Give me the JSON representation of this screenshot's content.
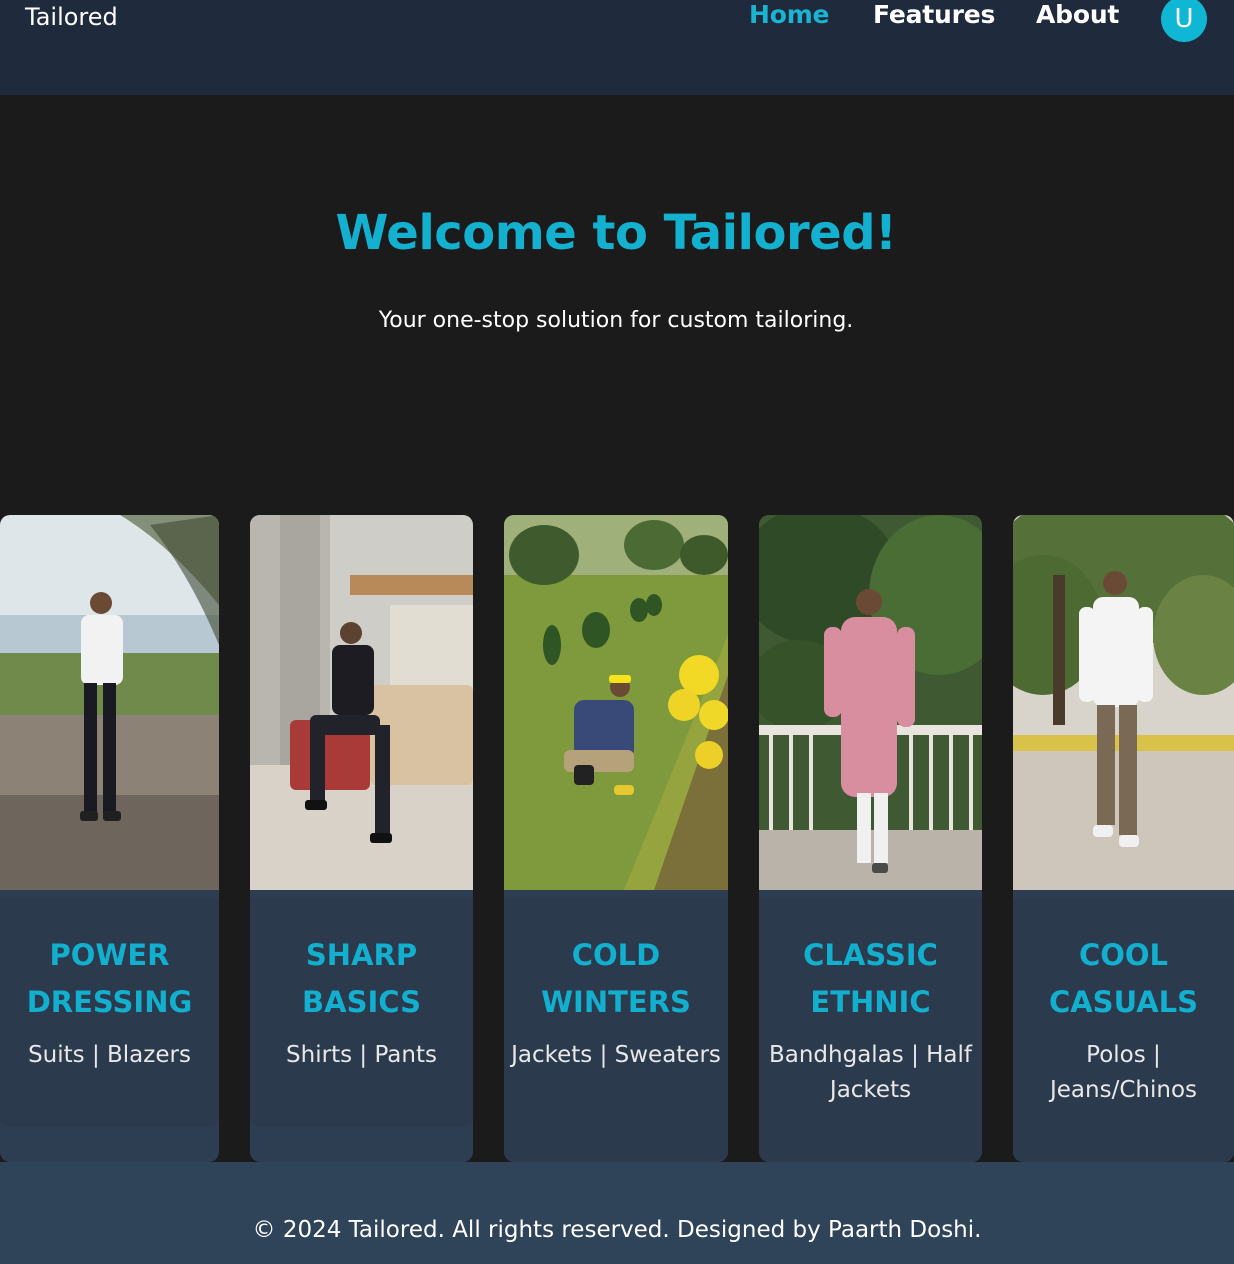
{
  "navbar": {
    "brand": "Tailored",
    "links": [
      {
        "label": "Home",
        "active": true
      },
      {
        "label": "Features",
        "active": false
      },
      {
        "label": "About",
        "active": false
      }
    ],
    "avatar_initial": "U"
  },
  "hero": {
    "title": "Welcome to Tailored!",
    "subtitle": "Your one-stop solution for custom tailoring."
  },
  "cards": [
    {
      "title": "POWER DRESSING",
      "description": "Suits | Blazers"
    },
    {
      "title": "SHARP BASICS",
      "description": "Shirts | Pants"
    },
    {
      "title": "COLD WINTERS",
      "description": "Jackets | Sweaters"
    },
    {
      "title": "CLASSIC ETHNIC",
      "description": "Bandhgalas | Half Jackets"
    },
    {
      "title": "COOL CASUALS",
      "description": "Polos | Jeans/Chinos"
    }
  ],
  "footer": {
    "text": "© 2024 Tailored. All rights reserved. Designed by Paarth Doshi."
  },
  "colors": {
    "accent": "#13b0cf",
    "navbar_bg": "#1f2a3c",
    "page_bg": "#1b1b1b",
    "card_bg": "#2b3a4d",
    "footer_bg": "#2f4359"
  }
}
